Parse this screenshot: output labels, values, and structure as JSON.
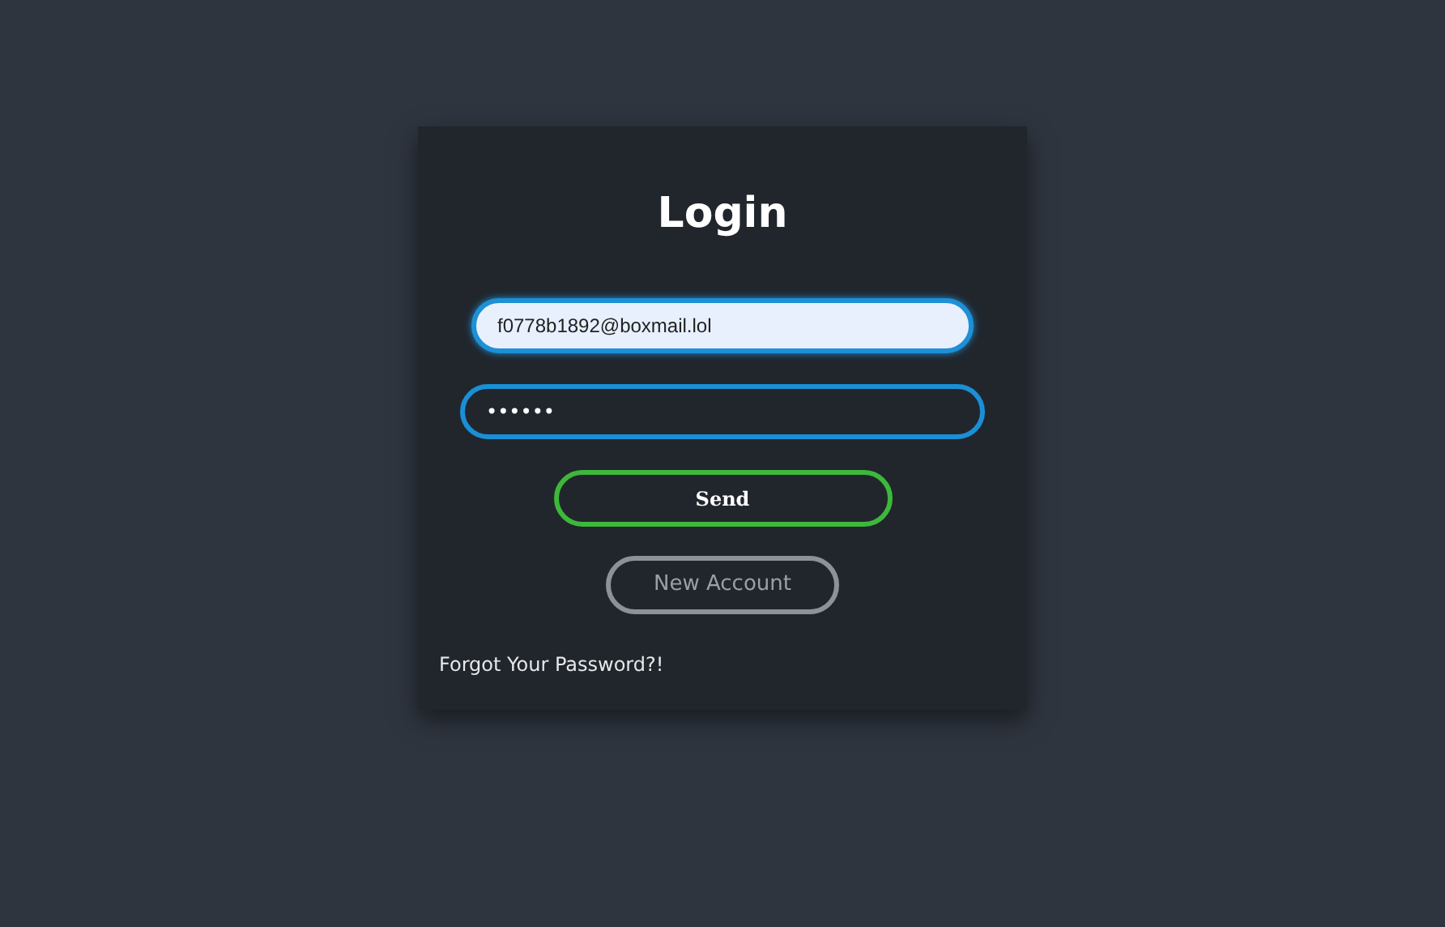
{
  "title": "Login",
  "email_field": {
    "value": "f0778b1892@boxmail.lol",
    "focused": true
  },
  "password_field": {
    "value": "••••••",
    "focused": false
  },
  "send_button": {
    "label": "Send"
  },
  "new_account_button": {
    "label": "New Account"
  },
  "forgot_link": "Forgot Your Password?!"
}
